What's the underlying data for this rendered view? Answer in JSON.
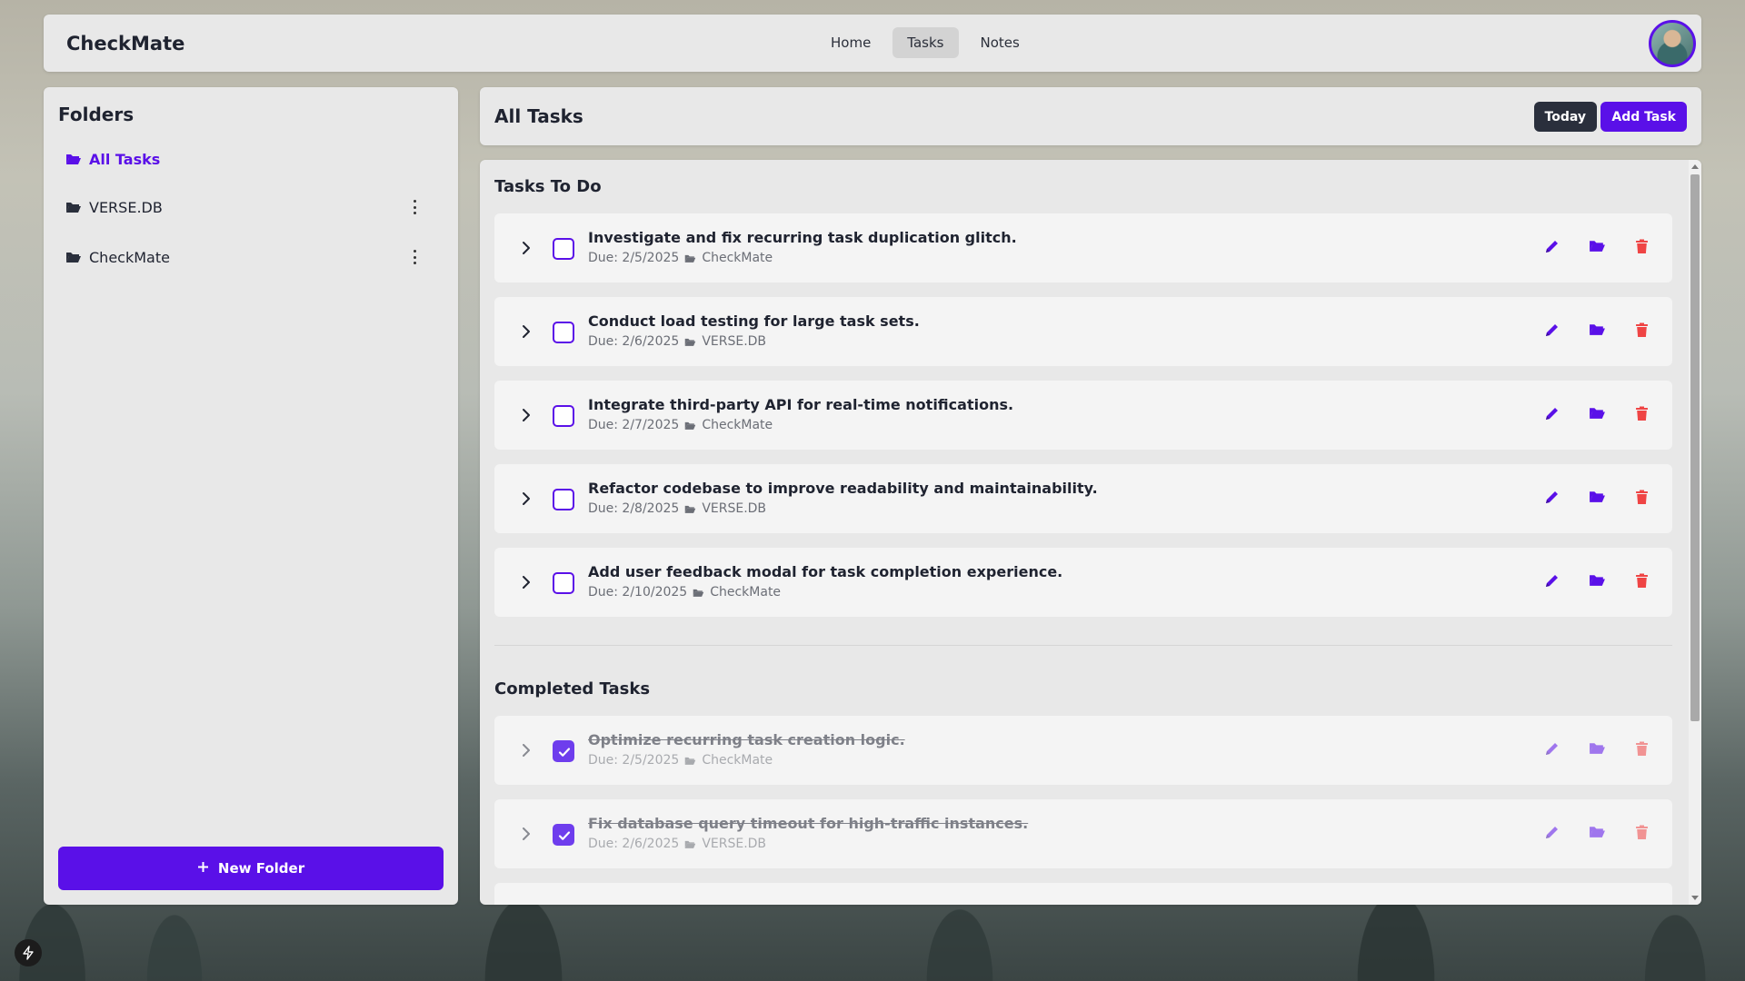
{
  "app": {
    "brand": "CheckMate"
  },
  "nav": [
    {
      "label": "Home",
      "active": false
    },
    {
      "label": "Tasks",
      "active": true
    },
    {
      "label": "Notes",
      "active": false
    }
  ],
  "folders": {
    "title": "Folders",
    "items": [
      {
        "label": "All Tasks",
        "active": true
      },
      {
        "label": "VERSE.DB",
        "active": false
      },
      {
        "label": "CheckMate",
        "active": false
      }
    ],
    "new_folder_label": "New Folder"
  },
  "header": {
    "title": "All Tasks",
    "today_label": "Today",
    "add_task_label": "Add Task"
  },
  "todo": {
    "title": "Tasks To Do",
    "tasks": [
      {
        "title": "Investigate and fix recurring task duplication glitch.",
        "due": "Due: 2/5/2025",
        "folder": "CheckMate"
      },
      {
        "title": "Conduct load testing for large task sets.",
        "due": "Due: 2/6/2025",
        "folder": "VERSE.DB"
      },
      {
        "title": "Integrate third-party API for real-time notifications.",
        "due": "Due: 2/7/2025",
        "folder": "CheckMate"
      },
      {
        "title": "Refactor codebase to improve readability and maintainability.",
        "due": "Due: 2/8/2025",
        "folder": "VERSE.DB"
      },
      {
        "title": "Add user feedback modal for task completion experience.",
        "due": "Due: 2/10/2025",
        "folder": "CheckMate"
      }
    ]
  },
  "completed": {
    "title": "Completed Tasks",
    "tasks": [
      {
        "title": "Optimize recurring task creation logic.",
        "due": "Due: 2/5/2025",
        "folder": "CheckMate"
      },
      {
        "title": "Fix database query timeout for high-traffic instances.",
        "due": "Due: 2/6/2025",
        "folder": "VERSE.DB"
      }
    ]
  },
  "colors": {
    "accent": "#5a10e8",
    "dark_button": "#2a2f3c",
    "delete": "#ef4444",
    "panel": "#e8e8e8"
  },
  "icons": [
    "folder-open-icon",
    "folder-icon",
    "kebab-icon",
    "plus-icon",
    "chevron-right-icon",
    "checkbox-icon",
    "pencil-icon",
    "move-folder-icon",
    "trash-icon",
    "bolt-icon"
  ]
}
